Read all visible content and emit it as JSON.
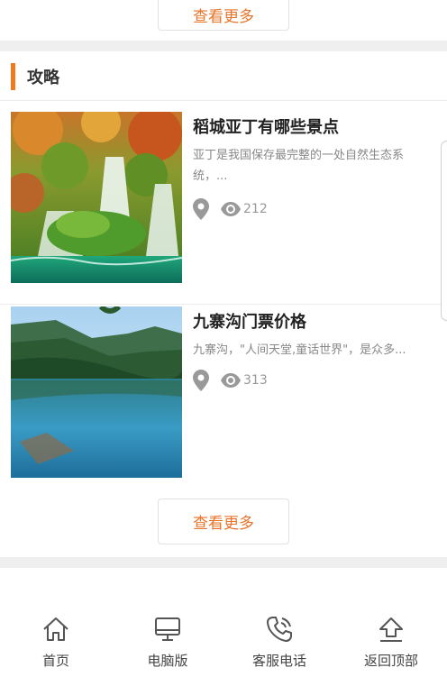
{
  "top": {
    "more_label": "查看更多"
  },
  "section": {
    "title": "攻略",
    "more_label": "查看更多"
  },
  "articles": [
    {
      "title": "稻城亚丁有哪些景点",
      "desc": "亚丁是我国保存最完整的一处自然生态系统，...",
      "views": "212",
      "image_icon": "waterfall-photo"
    },
    {
      "title": "九寨沟门票价格",
      "desc": "九寨沟，\"人间天堂,童话世界\"，是众多...",
      "views": "313",
      "image_icon": "lake-photo"
    }
  ],
  "nav": [
    {
      "label": "首页",
      "icon": "home-icon"
    },
    {
      "label": "电脑版",
      "icon": "desktop-icon"
    },
    {
      "label": "客服电话",
      "icon": "phone-icon"
    },
    {
      "label": "返回顶部",
      "icon": "back-to-top-icon"
    }
  ],
  "colors": {
    "accent": "#f07a1e",
    "button_text": "#e8742a"
  }
}
